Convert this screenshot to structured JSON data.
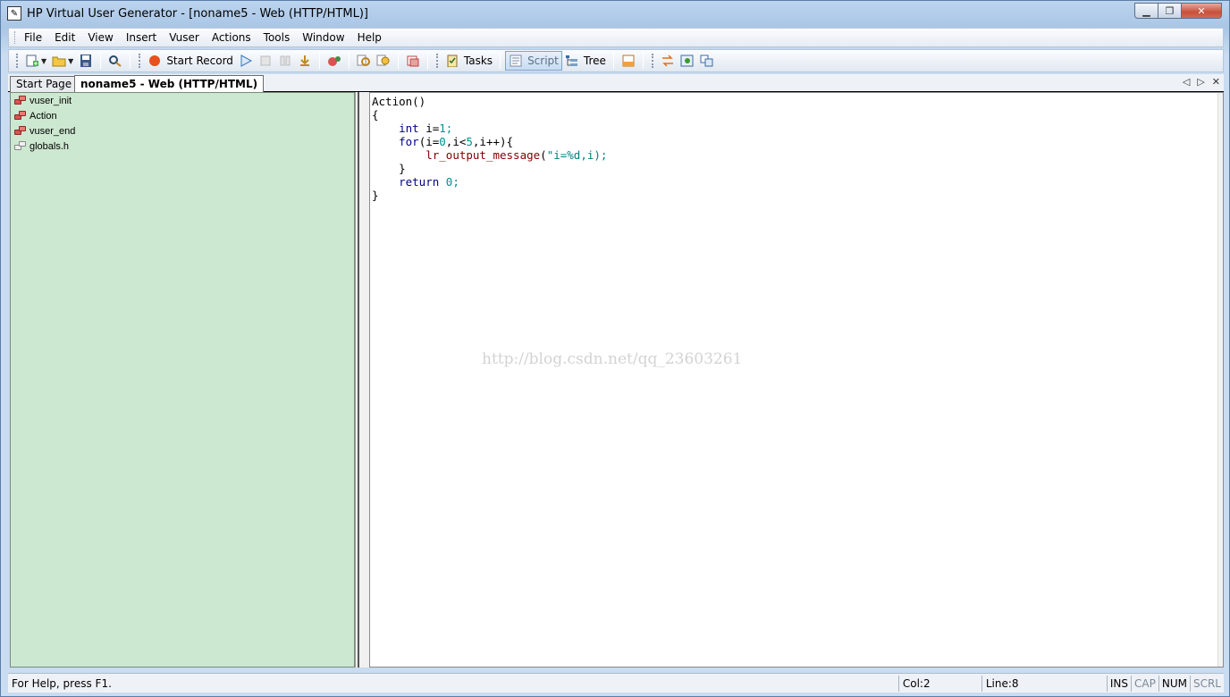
{
  "window": {
    "title": "HP Virtual User Generator - [noname5 - Web (HTTP/HTML)]",
    "controls": [
      "minimize",
      "restore",
      "close"
    ]
  },
  "menu": {
    "items": [
      "File",
      "Edit",
      "View",
      "Insert",
      "Vuser",
      "Actions",
      "Tools",
      "Window",
      "Help"
    ]
  },
  "toolbar": {
    "start_record_label": "Start Record",
    "tasks_label": "Tasks",
    "script_label": "Script",
    "tree_label": "Tree"
  },
  "tabs": {
    "start_page": "Start Page",
    "script_tab": "noname5 - Web (HTTP/HTML)"
  },
  "tree": {
    "items": [
      "vuser_init",
      "Action",
      "vuser_end",
      "globals.h"
    ]
  },
  "editor": {
    "code_lines": [
      "Action()",
      "{",
      "    int i=1;",
      "    for(i=0,i<5,i++){",
      "        lr_output_message(\"i=%d,i);",
      "    }",
      "    return 0;",
      "}"
    ],
    "watermark": "http://blog.csdn.net/qq_23603261"
  },
  "statusbar": {
    "help": "For Help, press F1.",
    "col": "Col:2",
    "line": "Line:8",
    "ins": "INS",
    "cap": "CAP",
    "num": "NUM",
    "scrl": "SCRL"
  },
  "colors": {
    "tree_background": "#cde8d0",
    "keyword": "#00008b",
    "number": "#009090",
    "function": "#800000"
  }
}
